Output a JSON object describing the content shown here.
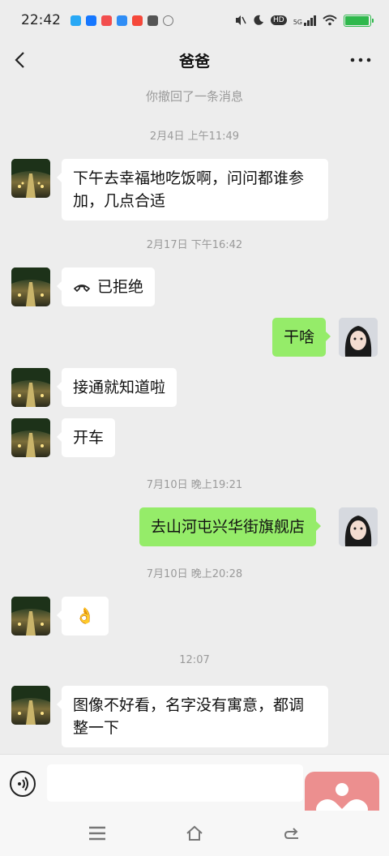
{
  "status_bar": {
    "time": "22:42",
    "apps": [
      {
        "name": "qq",
        "color": "#28a8f5",
        "glyph": "Q"
      },
      {
        "name": "zhihu",
        "color": "#1677ff",
        "glyph": "知乎"
      },
      {
        "name": "weibo",
        "color": "#f24e4e",
        "glyph": "微"
      },
      {
        "name": "app-blue",
        "color": "#2f8df5",
        "glyph": "J"
      },
      {
        "name": "app-red",
        "color": "#f5483a",
        "glyph": "阅"
      },
      {
        "name": "app-dark",
        "color": "#555555",
        "glyph": ""
      },
      {
        "name": "app-outline",
        "color": "#777777",
        "glyph": ""
      }
    ],
    "network_label": "5G",
    "hd_label": "HD",
    "battery_level": 0.95,
    "battery_color": "#2fb84c"
  },
  "nav": {
    "title": "爸爸"
  },
  "chat": {
    "system_message": "你撤回了一条消息",
    "timestamps": {
      "t1": "2月4日 上午11:49",
      "t2": "2月17日 下午16:42",
      "t3": "7月10日 晚上19:21",
      "t4": "7月10日 晚上20:28",
      "t5": "12:07"
    },
    "messages": {
      "m1": "下午去幸福地吃饭啊，问问都谁参加，几点合适",
      "m2_call": "已拒绝",
      "m3": "干啥",
      "m4": "接通就知道啦",
      "m5": "开车",
      "m6": "去山河屯兴华街旗舰店",
      "m7_emoji": "👌",
      "m8": "图像不好看，名字没有寓意，都调整一下"
    }
  },
  "input": {
    "placeholder": ""
  },
  "colors": {
    "background": "#ededed",
    "bubble_sent": "#95ec69",
    "bubble_received": "#ffffff",
    "float_app": "#ec8f8f"
  }
}
